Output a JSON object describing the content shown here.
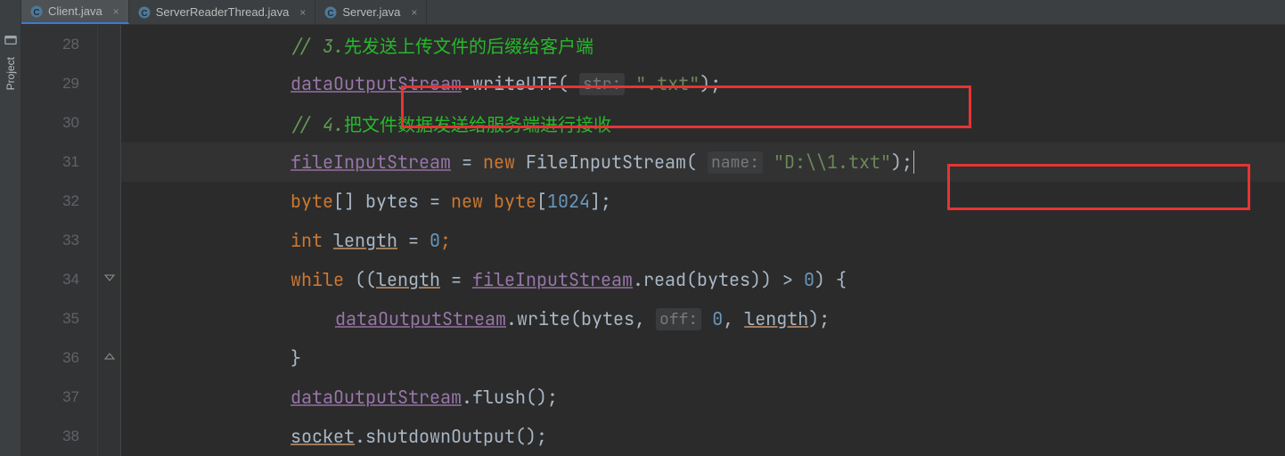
{
  "sidebar": {
    "label": "Project"
  },
  "tabs": [
    {
      "name": "Client.java",
      "active": true
    },
    {
      "name": "ServerReaderThread.java",
      "active": false
    },
    {
      "name": "Server.java",
      "active": false
    }
  ],
  "gutter": {
    "start": 28,
    "lines": [
      "28",
      "29",
      "30",
      "31",
      "32",
      "33",
      "34",
      "35",
      "36",
      "37",
      "38"
    ]
  },
  "code": {
    "l28": {
      "prefix": "// 3.",
      "rest": "先发送上传文件的后缀给客户端"
    },
    "l29": {
      "obj": "dataOutputStream",
      "method": "writeUTF",
      "hint": "str:",
      "string": "\".txt\""
    },
    "l30": {
      "prefix": "// 4.",
      "rest": "把文件数据发送给服务端进行接收"
    },
    "l31": {
      "obj": "fileInputStream",
      "op": " = ",
      "kw": "new ",
      "cls": "FileInputStream",
      "hint": "name:",
      "string": "\"D:\\\\1.txt\""
    },
    "l32": {
      "kw": "byte",
      "arr": "[] ",
      "var": "bytes",
      "op": " = ",
      "kw2": "new ",
      "kw3": "byte",
      "br": "[",
      "num": "1024",
      "br2": "];"
    },
    "l33": {
      "kw": "int ",
      "var": "length",
      "rest": " = ",
      "num": "0",
      "semi": ";"
    },
    "l34": {
      "kw": "while ",
      "open": "((",
      "var1": "length",
      "op": " = ",
      "obj": "fileInputStream",
      "method": "read",
      "p": "(",
      "arg": "bytes",
      "rest": ")) > ",
      "num": "0",
      "close": ") {"
    },
    "l35": {
      "obj": "dataOutputStream",
      "method": "write",
      "p": "(",
      "arg1": "bytes",
      "comma": ", ",
      "hint": "off:",
      "num": "0",
      "comma2": ", ",
      "arg2": "length",
      "close": ");"
    },
    "l36": {
      "close": "}"
    },
    "l37": {
      "obj": "dataOutputStream",
      "method": "flush",
      "rest": "();"
    },
    "l38": {
      "obj": "socket",
      "method": "shutdownOutput",
      "rest": "();"
    }
  }
}
